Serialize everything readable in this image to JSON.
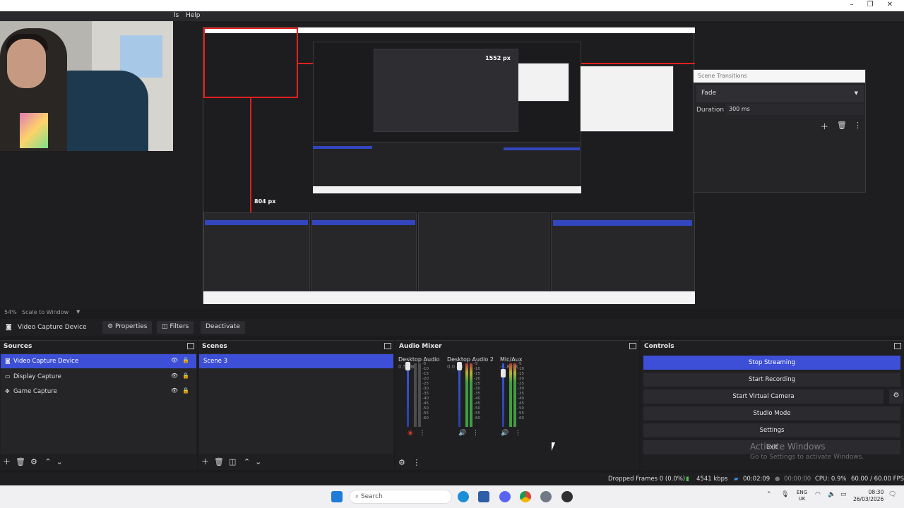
{
  "menu": {
    "tools_fragment": "ls",
    "help": "Help"
  },
  "preview": {
    "nested_px_labels": [
      "1552 px",
      "804 px"
    ],
    "scene_transitions": {
      "title": "Scene Transitions",
      "transition": "Fade",
      "duration_label": "Duration",
      "duration_value": "300 ms"
    }
  },
  "scale": {
    "percent": "54%",
    "mode": "Scale to Window"
  },
  "source_toolbar": {
    "source_name": "Video Capture Device",
    "properties": "Properties",
    "filters": "Filters",
    "deactivate": "Deactivate"
  },
  "sources": {
    "title": "Sources",
    "items": [
      {
        "label": "Video Capture Device",
        "selected": true
      },
      {
        "label": "Display Capture",
        "selected": false
      },
      {
        "label": "Game Capture",
        "selected": false
      }
    ]
  },
  "scenes": {
    "title": "Scenes",
    "items": [
      {
        "label": "Scene 3",
        "selected": true
      }
    ]
  },
  "audio_mixer": {
    "title": "Audio Mixer",
    "channels": [
      {
        "name": "Desktop Audio",
        "db": "0.5 dB"
      },
      {
        "name": "Desktop Audio 2",
        "db": "0.0 dB"
      },
      {
        "name": "Mic/Aux",
        "db": "-4.8 dB"
      }
    ],
    "ticks": [
      "-5",
      "-10",
      "-15",
      "-20",
      "-25",
      "-30",
      "-35",
      "-40",
      "-45",
      "-50",
      "-55",
      "-60"
    ]
  },
  "controls": {
    "title": "Controls",
    "stop_streaming": "Stop Streaming",
    "start_recording": "Start Recording",
    "start_virtual_camera": "Start Virtual Camera",
    "studio_mode": "Studio Mode",
    "settings": "Settings",
    "exit": "Exit",
    "watermark": "Activate Windows",
    "watermark_sub": "Go to Settings to activate Windows."
  },
  "status": {
    "dropped_frames": "Dropped Frames 0 (0.0%)",
    "bitrate": "4541 kbps",
    "stream_time": "00:02:09",
    "rec_time": "00:00:00",
    "cpu": "CPU: 0.9%",
    "fps": "60.00 / 60.00 FPS"
  },
  "taskbar": {
    "search": "Search",
    "lang_top": "ENG",
    "lang_bottom": "UK",
    "time": "08:30",
    "date": "26/03/2026"
  },
  "colors": {
    "accent": "#3d4fd6",
    "recording_red": "#e0201c"
  }
}
